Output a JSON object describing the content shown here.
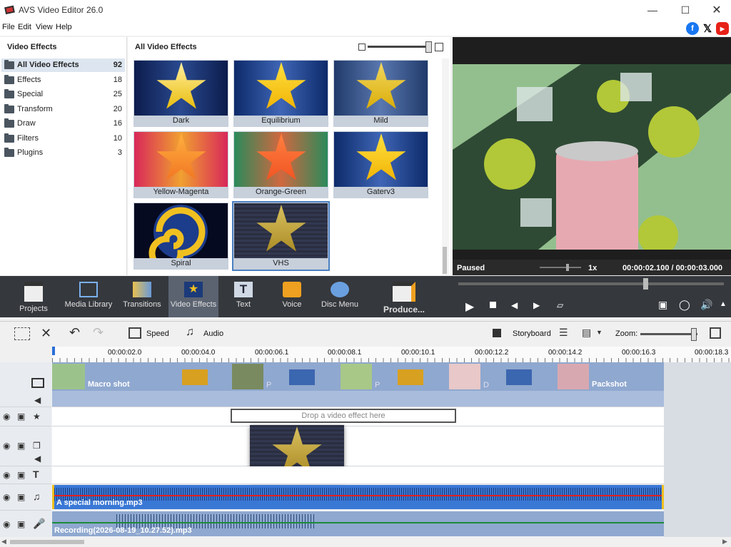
{
  "window": {
    "title": "AVS Video Editor 26.0"
  },
  "menu": [
    "File",
    "Edit",
    "View",
    "Help"
  ],
  "categories": {
    "header": "Video Effects",
    "items": [
      {
        "label": "All Video Effects",
        "count": "92"
      },
      {
        "label": "Effects",
        "count": "18"
      },
      {
        "label": "Special",
        "count": "25"
      },
      {
        "label": "Transform",
        "count": "20"
      },
      {
        "label": "Draw",
        "count": "16"
      },
      {
        "label": "Filters",
        "count": "10"
      },
      {
        "label": "Plugins",
        "count": "3"
      }
    ]
  },
  "gallery": {
    "header": "All Video Effects",
    "effects": [
      "Dark",
      "Equilibrium",
      "Mild",
      "Yellow-Magenta",
      "Orange-Green",
      "Gaterv3",
      "Spiral",
      "VHS"
    ]
  },
  "preview": {
    "status": "Paused",
    "speed": "1x",
    "time": "00:00:02.100 / 00:00:03.000"
  },
  "ribbon": [
    "Projects",
    "Media Library",
    "Transitions",
    "Video Effects",
    "Text",
    "Voice",
    "Disc Menu",
    "Produce..."
  ],
  "timeline_toolbar": {
    "speed": "Speed",
    "audio": "Audio",
    "storyboard": "Storyboard",
    "zoom": "Zoom:"
  },
  "ruler": [
    "00:00:02.0",
    "00:00:04.0",
    "00:00:06.1",
    "00:00:08.1",
    "00:00:10.1",
    "00:00:12.2",
    "00:00:14.2",
    "00:00:16.3",
    "00:00:18.3"
  ],
  "tracks": {
    "video_first": "Macro shot",
    "video_last": "Packshot",
    "transition_marks": [
      "P",
      "P",
      "D"
    ],
    "drop_hint": "Drop a video effect here",
    "audio1": "A special morning.mp3",
    "audio2": "Recording(2026-08-19_10.27.52).mp3"
  },
  "colors": {
    "accent": "#4a7fc1",
    "ribbon_bg": "#35383d",
    "clip_bg": "#8fa8cf",
    "audio_bg": "#3a78d6",
    "waveform": "#1c3d7a"
  }
}
